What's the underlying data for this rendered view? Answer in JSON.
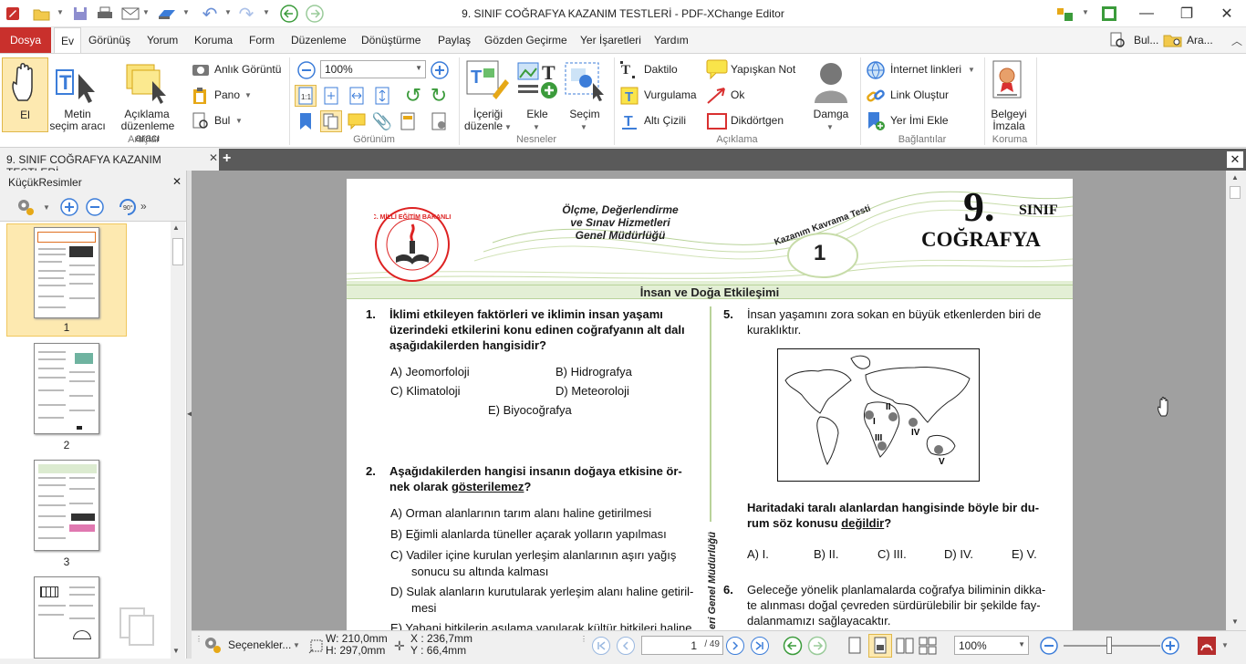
{
  "app": {
    "title": "9. SINIF COĞRAFYA KAZANIM TESTLERİ - PDF-XChange Editor"
  },
  "menu": {
    "tabs": [
      "Dosya",
      "Ev",
      "Görünüş",
      "Yorum",
      "Koruma",
      "Form",
      "Düzenleme",
      "Dönüştürme",
      "Paylaş",
      "Gözden Geçirme",
      "Yer İşaretleri",
      "Yardım"
    ],
    "right": {
      "find": "Bul...",
      "search": "Ara..."
    }
  },
  "ribbon": {
    "tools": {
      "hand": "El",
      "text_select_1": "Metin",
      "text_select_2": "seçim aracı",
      "annot_select_1": "Açıklama",
      "annot_select_2": "düzenleme aracı",
      "snapshot": "Anlık Görüntü",
      "clipboard": "Pano",
      "find": "Bul",
      "group": "Araçlar"
    },
    "view": {
      "zoom": "100%",
      "group": "Görünüm"
    },
    "objects": {
      "edit_content_1": "İçeriği",
      "edit_content_2": "düzenle",
      "add": "Ekle",
      "select": "Seçim",
      "group": "Nesneler"
    },
    "comment": {
      "typewriter": "Daktilo",
      "highlight": "Vurgulama",
      "underline": "Altı Çizili",
      "sticky": "Yapışkan Not",
      "arrow": "Ok",
      "rectangle": "Dikdörtgen",
      "stamp": "Damga",
      "group": "Açıklama"
    },
    "links": {
      "web_links": "İnternet linkleri",
      "create_link": "Link Oluştur",
      "add_bookmark": "Yer İmi Ekle",
      "group": "Bağlantılar"
    },
    "protect": {
      "sign_1": "Belgeyi",
      "sign_2": "İmzala",
      "group": "Koruma"
    }
  },
  "doc_tab": {
    "label": "9. SINIF COĞRAFYA KAZANIM TESTLERİ"
  },
  "thumbnails": {
    "title": "KüçükResimler",
    "pages": [
      "1",
      "2",
      "3"
    ]
  },
  "page": {
    "header_agency_1": "Ölçme, Değerlendirme",
    "header_agency_2": "ve Sınav Hizmetleri",
    "header_agency_3": "Genel Müdürlüğü",
    "logo_text": "T.C. MİLLİ EĞİTİM BAKANLIĞI",
    "test_label": "Kazanım Kavrama Testi",
    "test_number": "1",
    "grade_num": "9.",
    "grade_word": "SINIF",
    "subject": "COĞRAFYA",
    "section_title": "İnsan ve Doğa Etkileşimi",
    "side_text": "eri Genel Müdürlüğü",
    "q1": {
      "num": "1.",
      "line1": "İklimi etkileyen faktörleri ve iklimin insan yaşamı",
      "line2": "üzerindeki etkilerini konu edinen coğrafyanın alt dalı",
      "line3": "aşağıdakilerden hangisidir?",
      "a": "A)  Jeomorfoloji",
      "b": "B)  Hidrografya",
      "c": "C)  Klimatoloji",
      "d": "D) Meteoroloji",
      "e": "E) Biyocoğrafya"
    },
    "q2": {
      "num": "2.",
      "line1": "Aşağıdakilerden hangisi insanın doğaya etkisine ör-",
      "line2_pre": "nek olarak ",
      "line2_u": "gösterilemez",
      "line2_post": "?",
      "a": "A)  Orman alanlarının tarım alanı haline getirilmesi",
      "b": "B)  Eğimli alanlarda tüneller açarak yolların yapılması",
      "c1": "C)  Vadiler içine kurulan yerleşim alanlarının aşırı yağış",
      "c2": "sonucu su altında kalması",
      "d1": "D)  Sulak alanların kurutularak yerleşim alanı haline getiril-",
      "d2": "mesi",
      "e": "E)  Yabani bitkilerin aşılama yapılarak kültür bitkileri haline"
    },
    "q5": {
      "num": "5.",
      "line1": "İnsan yaşamını zora sokan en büyük etkenlerden biri de",
      "line2": "kuraklıktır.",
      "map_labels": [
        "I",
        "II",
        "III",
        "IV",
        "V"
      ],
      "ask1": "Haritadaki taralı alanlardan hangisinde böyle bir du-",
      "ask2_pre": "rum söz konusu ",
      "ask2_u": "değildir",
      "ask2_post": "?",
      "opts": [
        "A) I.",
        "B) II.",
        "C) III.",
        "D) IV.",
        "E) V."
      ]
    },
    "q6": {
      "num": "6.",
      "line1": "Geleceğe yönelik planlamalarda coğrafya biliminin dikka-",
      "line2": "te alınması doğal çevreden sürdürülebilir bir şekilde fay-",
      "line3": "dalanmamızı sağlayacaktır."
    }
  },
  "status": {
    "options": "Seçenekler...",
    "width": "W: 210,0mm",
    "height": "H: 297,0mm",
    "x": "X : 236,7mm",
    "y": "Y :   66,4mm",
    "page_current": "1",
    "page_total": "/ 49",
    "zoom": "100%"
  }
}
